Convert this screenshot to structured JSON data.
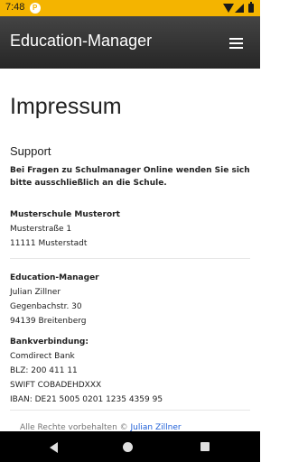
{
  "status_bar": {
    "time": "7:48",
    "app_badge": "P"
  },
  "app_bar": {
    "title": "Education-Manager",
    "menu_icon": "hamburger-menu-icon"
  },
  "page": {
    "heading": "Impressum",
    "support_heading": "Support",
    "support_text": "Bei Fragen zu Schulmanager Online wenden Sie sich bitte ausschließlich an die Schule.",
    "school": {
      "name": "Musterschule Musterort",
      "street": "Musterstraße 1",
      "city": "11111 Musterstadt"
    },
    "company": {
      "name": "Education-Manager",
      "person": "Julian Zillner",
      "street": "Gegenbachstr. 30",
      "city": "94139 Breitenberg"
    },
    "bank": {
      "label": "Bankverbindung:",
      "bank_name": "Comdirect Bank",
      "blz": "BLZ: 200 411 11",
      "swift": "SWIFT COBADEHDXXX",
      "iban": "IBAN: DE21 5005 0201 1235 4359 95"
    },
    "footer": {
      "text": "Alle Rechte vorbehalten ©",
      "link": "Julian Zillner"
    }
  },
  "nav_bar": {
    "back": "back-icon",
    "home": "home-icon",
    "recent": "recent-apps-icon"
  },
  "colors": {
    "status_bar": "#f4b400",
    "app_bar": "#2d2d2d",
    "link": "#1e5fd8"
  }
}
